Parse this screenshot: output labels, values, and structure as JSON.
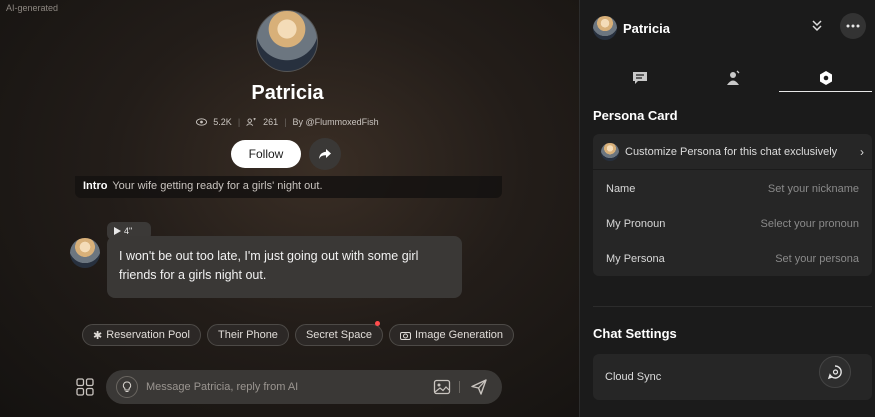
{
  "badge": {
    "ai_generated": "AI-generated"
  },
  "persona": {
    "name": "Patricia",
    "views": "5.2K",
    "followers": "261",
    "author": "By @FlummoxedFish"
  },
  "actions": {
    "follow_label": "Follow"
  },
  "intro": {
    "label": "Intro",
    "text": "Your wife getting ready for a girls' night out."
  },
  "message": {
    "audio_duration": "4\"",
    "text": "I won't be out too late, I'm just going out with some girl friends for a girls night out."
  },
  "chips": [
    {
      "label": "Reservation Pool",
      "icon": "sparkle-icon"
    },
    {
      "label": "Their Phone",
      "icon": ""
    },
    {
      "label": "Secret Space",
      "icon": "",
      "notification_dot": true
    },
    {
      "label": "Image Generation",
      "icon": "camera-icon"
    }
  ],
  "composer": {
    "placeholder": "Message Patricia, reply from AI"
  },
  "side_panel": {
    "name": "Patricia",
    "tabs": [
      "chat-tab",
      "profile-tab",
      "settings-tab"
    ],
    "active_tab": 2,
    "persona_card": {
      "title": "Persona Card",
      "customize": "Customize Persona for this chat exclusively",
      "rows": [
        {
          "label": "Name",
          "value": "Set your nickname"
        },
        {
          "label": "My Pronoun",
          "value": "Select your pronoun"
        },
        {
          "label": "My Persona",
          "value": "Set your persona"
        }
      ]
    },
    "chat_settings": {
      "title": "Chat Settings",
      "cloud_sync": "Cloud Sync"
    }
  },
  "colors": {
    "accent": "#ffffff",
    "notification": "#ff4d4d",
    "panel_bg": "#1b1b1b"
  }
}
